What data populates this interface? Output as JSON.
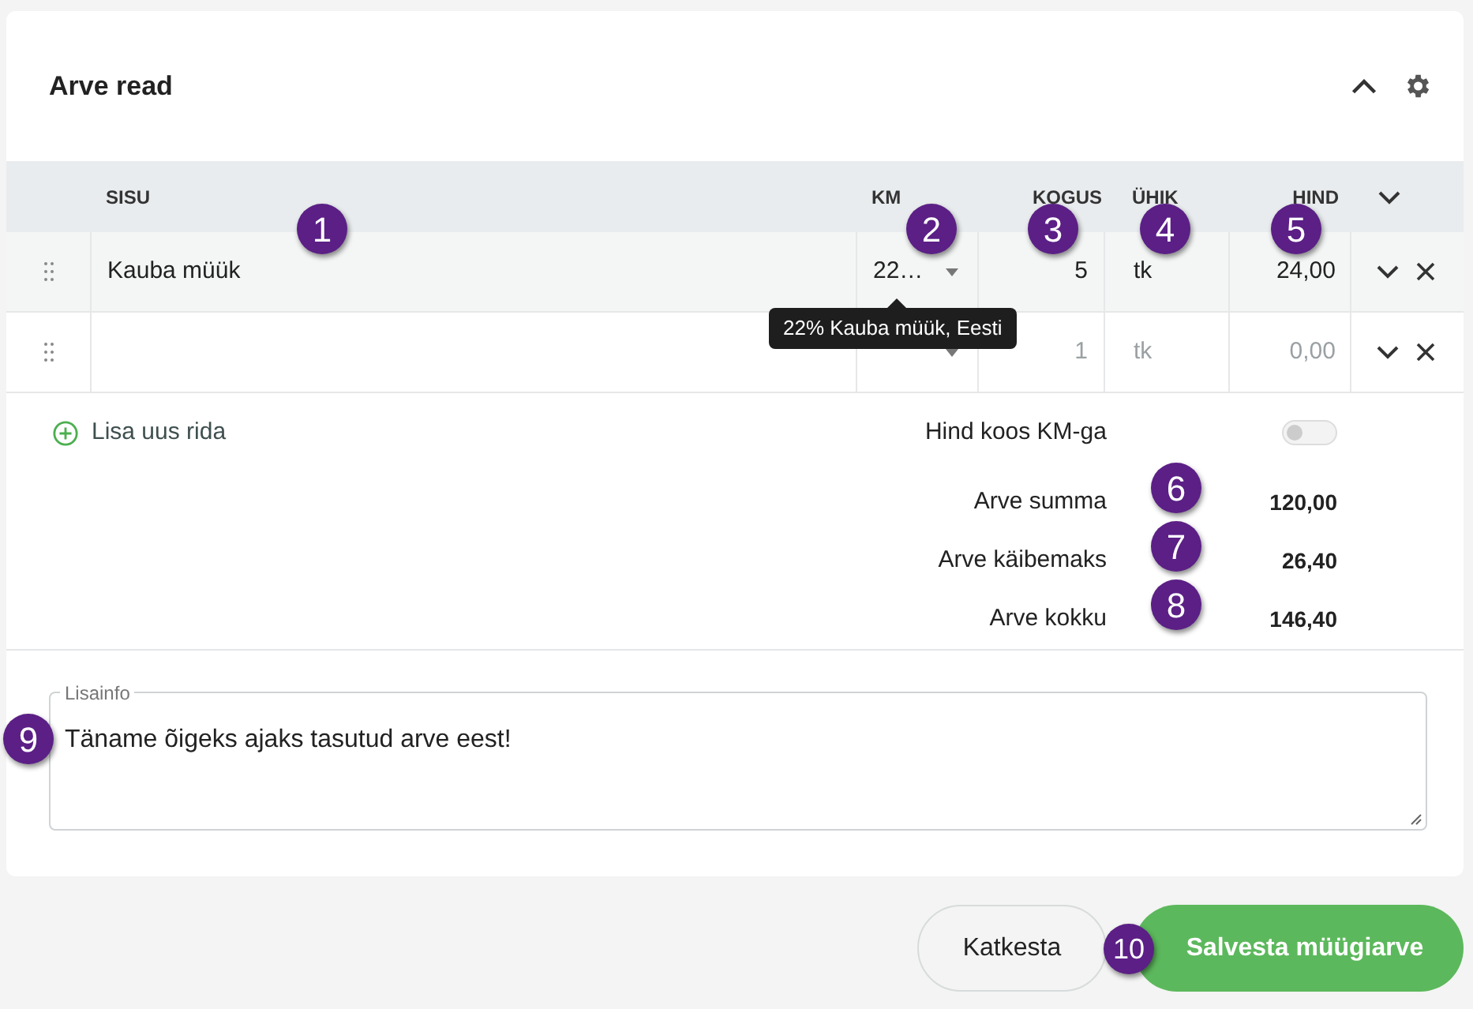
{
  "panel": {
    "title": "Arve read",
    "collapsed": false
  },
  "table": {
    "columns": [
      "SISU",
      "KM",
      "KOGUS",
      "ÜHIK",
      "HIND"
    ],
    "rows": [
      {
        "description": "Kauba müük",
        "vat": "22…",
        "quantity": "5",
        "unit": "tk",
        "price": "24,00",
        "placeholder": false
      },
      {
        "description": "",
        "quantity": "1",
        "unit": "tk",
        "price": "0,00",
        "placeholder": true
      }
    ]
  },
  "tooltip": "22% Kauba müük, Eesti",
  "add_row": "Lisa uus rida",
  "price_incl_vat": {
    "label": "Hind koos KM-ga",
    "on": false
  },
  "totals": [
    {
      "label": "Arve summa",
      "value": "120,00"
    },
    {
      "label": "Arve käibemaks",
      "value": "26,40"
    },
    {
      "label": "Arve kokku",
      "value": "146,40"
    }
  ],
  "notes": {
    "label": "Lisainfo",
    "value": "Täname õigeks ajaks tasutud arve eest!"
  },
  "buttons": {
    "cancel": "Katkesta",
    "save": "Salvesta müügiarve"
  },
  "markers": [
    "1",
    "2",
    "3",
    "4",
    "5",
    "6",
    "7",
    "8",
    "9",
    "10"
  ]
}
